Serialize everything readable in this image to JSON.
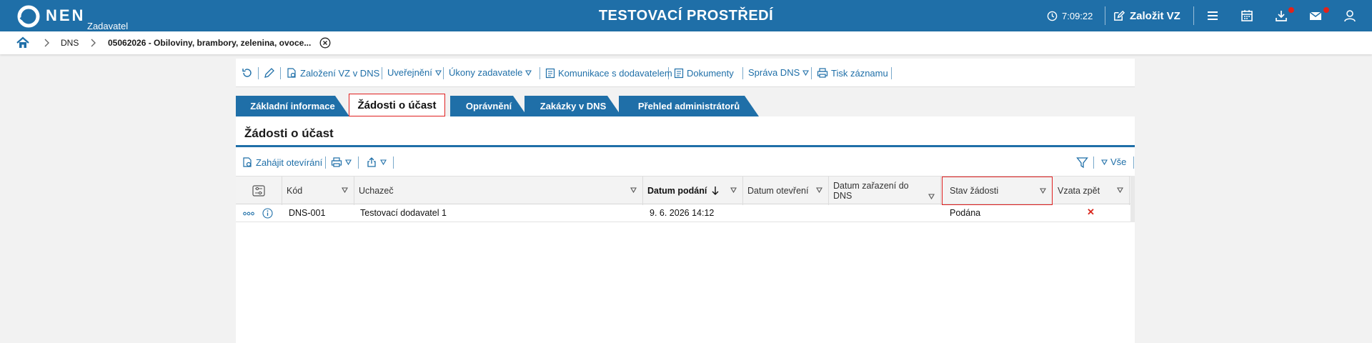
{
  "header": {
    "brand": "NEN",
    "role": "Zadavatel",
    "env_title": "TESTOVACÍ PROSTŘEDÍ",
    "timer": "7:09:22",
    "create_vz_label": "Založit VZ",
    "icons": [
      "clock-icon",
      "edit-icon",
      "menu-icon",
      "calendar-icon",
      "download-icon",
      "mail-icon",
      "user-icon"
    ],
    "accent_color": "#1f6fa8",
    "notification_color": "#e2231a"
  },
  "breadcrumb": {
    "items": [
      "DNS",
      "05062026 - Obiloviny, brambory, zelenina, ovoce..."
    ]
  },
  "actions": {
    "zalozeni_vz": "Založení VZ v DNS",
    "uverejneni": "Uveřejnění",
    "ukony": "Úkony zadavatele",
    "komunikace": "Komunikace s dodavatelem",
    "dokumenty": "Dokumenty",
    "sprava_dns": "Správa DNS",
    "tisk": "Tisk záznamu"
  },
  "tabs": [
    {
      "label": "Základní informace",
      "active": false
    },
    {
      "label": "Žádosti o účast",
      "active": true
    },
    {
      "label": "Oprávnění",
      "active": false
    },
    {
      "label": "Zakázky v DNS",
      "active": false
    },
    {
      "label": "Přehled administrátorů",
      "active": false
    }
  ],
  "panel": {
    "title": "Žádosti o účast",
    "zahajit": "Zahájit otevírání",
    "filter_all": "Vše"
  },
  "table": {
    "columns": [
      "Kód",
      "Uchazeč",
      "Datum podání",
      "Datum otevření",
      "Datum zařazení do DNS",
      "Stav žádosti",
      "Vzata zpět"
    ],
    "sorted_column": "Datum podání",
    "rows": [
      {
        "kod": "DNS-001",
        "uchazec": "Testovací dodavatel 1",
        "datum_podani": "9. 6. 2026 14:12",
        "datum_otevreni": "",
        "datum_zarazeni": "",
        "stav": "Podána",
        "vzata_zpet": "✕"
      }
    ]
  }
}
